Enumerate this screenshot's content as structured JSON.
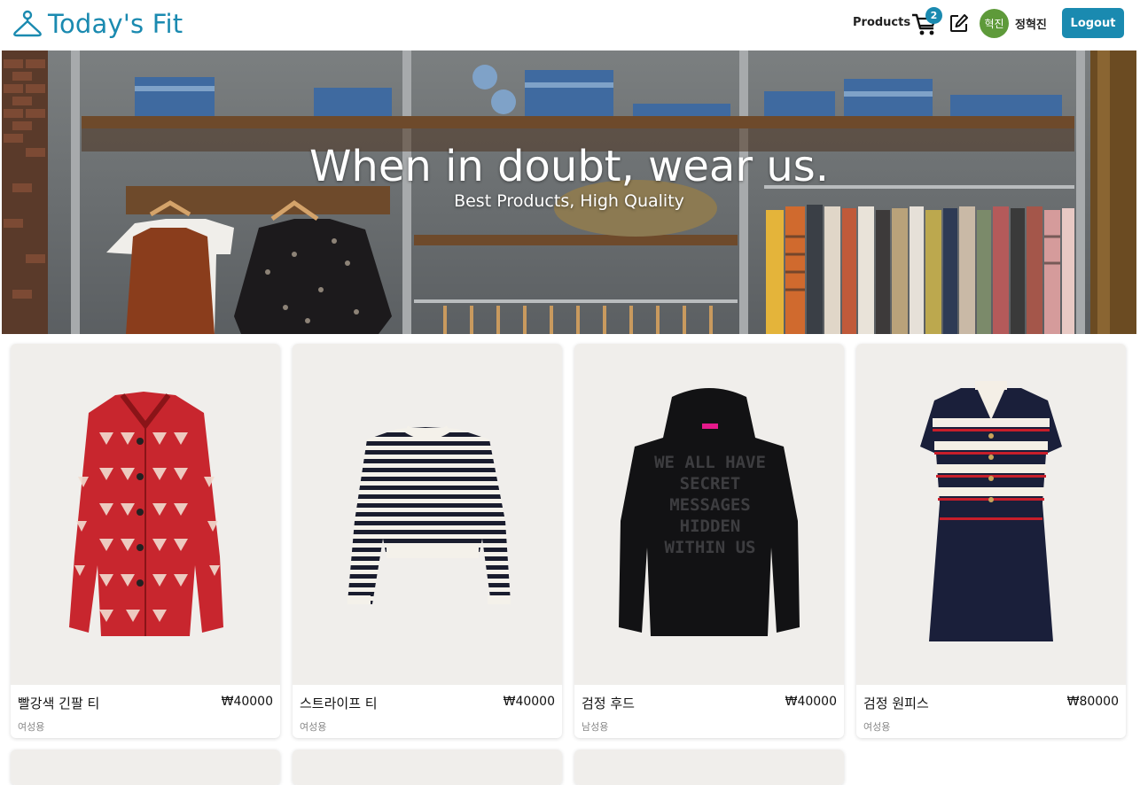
{
  "header": {
    "logo_text": "Today's Fit",
    "nav_products": "Products",
    "cart_count": "2",
    "avatar_text": "혁진",
    "username": "정혁진",
    "logout_label": "Logout"
  },
  "hero": {
    "title": "When in doubt, wear us.",
    "subtitle": "Best Products, High Quality"
  },
  "products": [
    {
      "name": "빨강색 긴팔 티",
      "price": "₩40000",
      "category": "여성용"
    },
    {
      "name": "스트라이프 티",
      "price": "₩40000",
      "category": "여성용"
    },
    {
      "name": "검정 후드",
      "price": "₩40000",
      "category": "남성용"
    },
    {
      "name": "검정 원피스",
      "price": "₩80000",
      "category": "여성용"
    }
  ],
  "hoodie_print": [
    "WE ALL HAVE",
    "SECRET",
    "MESSAGES",
    "HIDDEN",
    "WITHIN US"
  ],
  "colors": {
    "accent": "#1a8ab0",
    "avatar": "#5e9a3a",
    "card_bg": "#f0eeeb"
  }
}
